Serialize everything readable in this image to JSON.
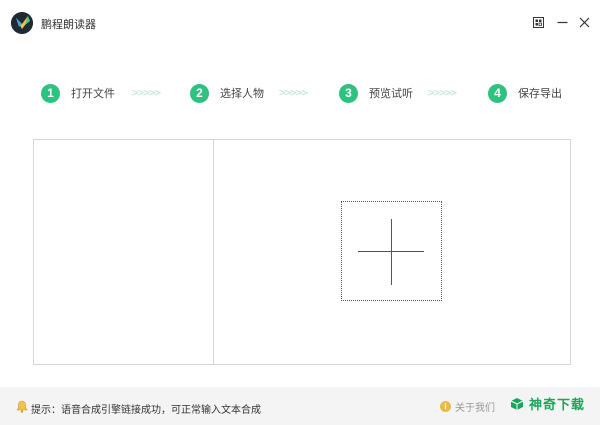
{
  "window": {
    "title": "鹏程朗读器",
    "controls": {
      "skin_icon": "skin-grid-icon",
      "minimize_icon": "minimize-icon",
      "close_icon": "close-icon"
    }
  },
  "steps": [
    {
      "number": "1",
      "label": "打开文件"
    },
    {
      "number": "2",
      "label": "选择人物"
    },
    {
      "number": "3",
      "label": "预览试听"
    },
    {
      "number": "4",
      "label": "保存导出"
    }
  ],
  "step_separator": ">>>>>",
  "workspace": {
    "add_icon": "plus-icon"
  },
  "statusbar": {
    "tip": "提示：语音合成引擎链接成功，可正常输入文本合成",
    "about": "关于我们",
    "about_icon": "info-icon",
    "watermark": "神奇下载"
  },
  "colors": {
    "accent": "#2ec27e",
    "separator": "#b8e6cf",
    "statusbar_bg": "#f4f4f4",
    "border": "#d6d6d6",
    "watermark": "#1aa55a"
  }
}
